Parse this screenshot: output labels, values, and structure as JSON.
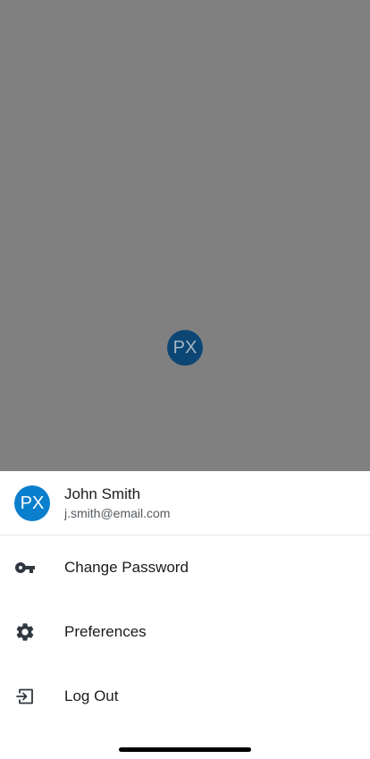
{
  "backdrop": {
    "avatar_initials": "PX"
  },
  "profile": {
    "avatar_initials": "PX",
    "name": "John Smith",
    "email": "j.smith@email.com"
  },
  "menu": {
    "items": [
      {
        "label": "Change Password",
        "icon": "key-icon"
      },
      {
        "label": "Preferences",
        "icon": "gear-icon"
      },
      {
        "label": "Log Out",
        "icon": "logout-icon"
      }
    ]
  },
  "colors": {
    "backdrop": "#808080",
    "avatar_accent": "#0a7fce",
    "text_primary": "#1b1b1b",
    "text_secondary": "#555a5f"
  }
}
